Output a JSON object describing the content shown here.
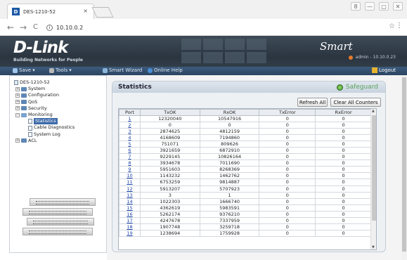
{
  "browser": {
    "tab_title": "DES-1210-52",
    "tab_close": "×",
    "favicon_letter": "D",
    "url": "10.10.0.2",
    "url_icon": "info-icon",
    "nav_back": "←",
    "nav_forward": "→",
    "nav_reload": "C",
    "star": "☆",
    "menu": "⋮",
    "window_controls": [
      "8",
      "—",
      "▢",
      "✕"
    ]
  },
  "banner": {
    "logo": "D-Link",
    "tagline": "Building Networks for People",
    "product": "Smart",
    "user_info": "admin - 10.10.0.23"
  },
  "toolbar": {
    "save": "Save",
    "tools": "Tools",
    "smart_wizard": "Smart Wizard",
    "online_help": "Online Help",
    "logout": "Logout"
  },
  "tree": [
    {
      "label": "DES-1210-52",
      "level": 0,
      "type": "root"
    },
    {
      "label": "System",
      "level": 1,
      "type": "folder"
    },
    {
      "label": "Configuration",
      "level": 1,
      "type": "folder"
    },
    {
      "label": "QoS",
      "level": 1,
      "type": "folder"
    },
    {
      "label": "Security",
      "level": 1,
      "type": "folder"
    },
    {
      "label": "Monitoring",
      "level": 1,
      "type": "folder-open"
    },
    {
      "label": "Statistics",
      "level": 2,
      "type": "page",
      "selected": true
    },
    {
      "label": "Cable Diagnostics",
      "level": 2,
      "type": "page"
    },
    {
      "label": "System Log",
      "level": 2,
      "type": "page"
    },
    {
      "label": "ACL",
      "level": 1,
      "type": "folder"
    }
  ],
  "panel": {
    "title": "Statistics",
    "safeguard": "Safeguard",
    "refresh_all": "Refresh All",
    "clear_all": "Clear All Counters"
  },
  "table": {
    "headers": [
      "Port",
      "TxOK",
      "RxOK",
      "TxError",
      "RxError"
    ],
    "rows": [
      [
        "1",
        "12320040",
        "10547916",
        "0",
        "0"
      ],
      [
        "2",
        "0",
        "0",
        "0",
        "0"
      ],
      [
        "3",
        "2874625",
        "4812159",
        "0",
        "0"
      ],
      [
        "4",
        "4168609",
        "7194860",
        "0",
        "0"
      ],
      [
        "5",
        "751071",
        "809626",
        "0",
        "0"
      ],
      [
        "6",
        "3921659",
        "6872910",
        "0",
        "0"
      ],
      [
        "7",
        "9229145",
        "10826164",
        "0",
        "0"
      ],
      [
        "8",
        "3934678",
        "7011690",
        "0",
        "0"
      ],
      [
        "9",
        "5951603",
        "8268369",
        "0",
        "0"
      ],
      [
        "10",
        "1143232",
        "1462762",
        "0",
        "0"
      ],
      [
        "11",
        "6753259",
        "9814887",
        "0",
        "0"
      ],
      [
        "12",
        "5913207",
        "5707923",
        "0",
        "0"
      ],
      [
        "13",
        "3",
        "1",
        "0",
        "0"
      ],
      [
        "14",
        "1022303",
        "1666740",
        "0",
        "0"
      ],
      [
        "15",
        "4362619",
        "5983591",
        "0",
        "0"
      ],
      [
        "16",
        "5262174",
        "9376210",
        "0",
        "0"
      ],
      [
        "17",
        "4247678",
        "7337959",
        "0",
        "0"
      ],
      [
        "18",
        "1907748",
        "3259718",
        "0",
        "0"
      ],
      [
        "19",
        "1238694",
        "1759928",
        "0",
        "0"
      ]
    ]
  }
}
